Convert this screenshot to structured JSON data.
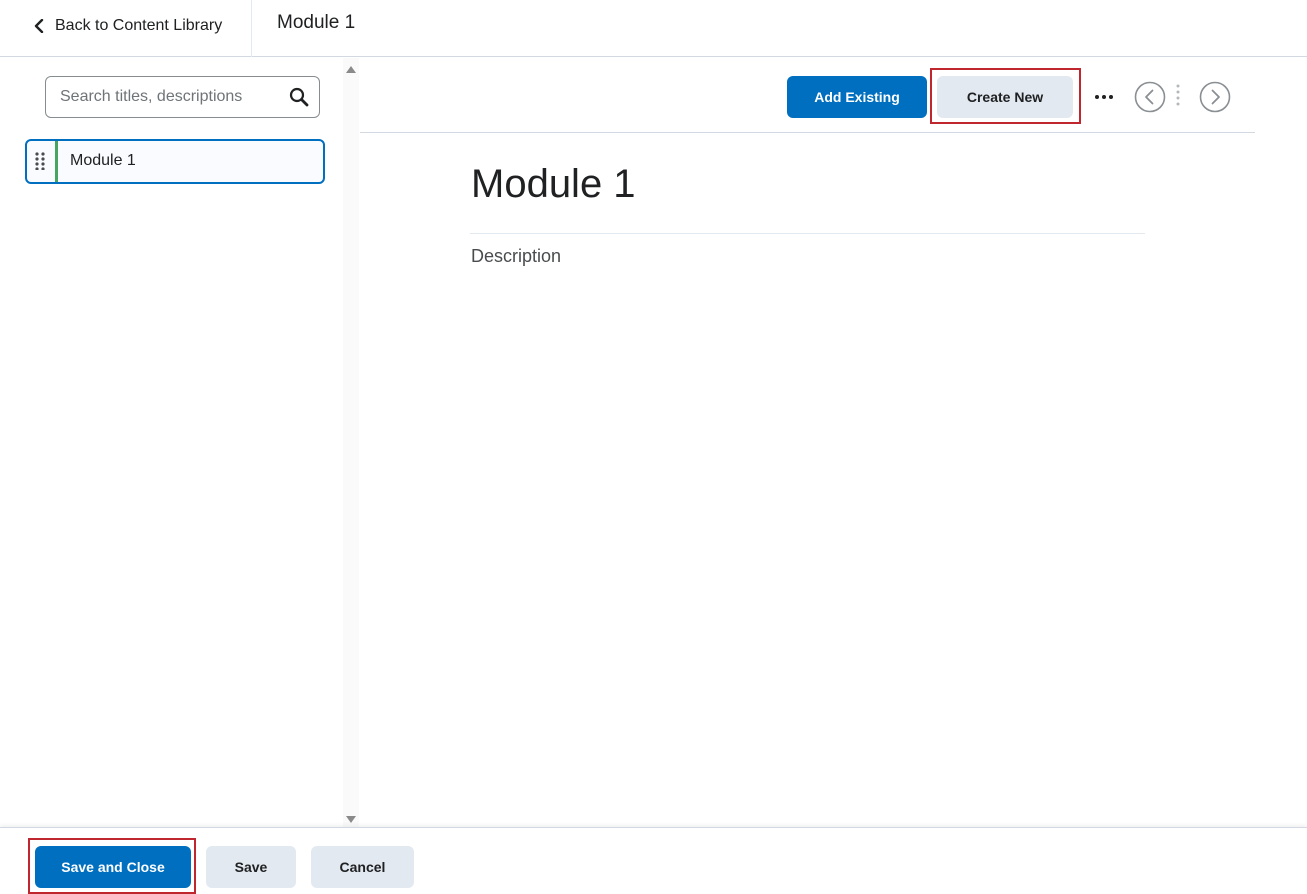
{
  "header": {
    "back_label": "Back to Content Library",
    "title": "Module 1"
  },
  "sidebar": {
    "search": {
      "placeholder": "Search titles, descriptions",
      "value": ""
    },
    "items": [
      {
        "label": "Module 1",
        "accent_color": "#46a661"
      }
    ]
  },
  "toolbar": {
    "add_existing_label": "Add Existing",
    "create_new_label": "Create New",
    "icons": [
      "more-options-icon",
      "previous-icon",
      "next-icon"
    ]
  },
  "content": {
    "heading": "Module 1",
    "description_placeholder": "Description"
  },
  "footer": {
    "save_close_label": "Save and Close",
    "save_label": "Save",
    "cancel_label": "Cancel"
  },
  "colors": {
    "primary": "#006fbf",
    "secondary": "#e3e9f1",
    "highlight": "#c0262d",
    "text": "#202122"
  }
}
